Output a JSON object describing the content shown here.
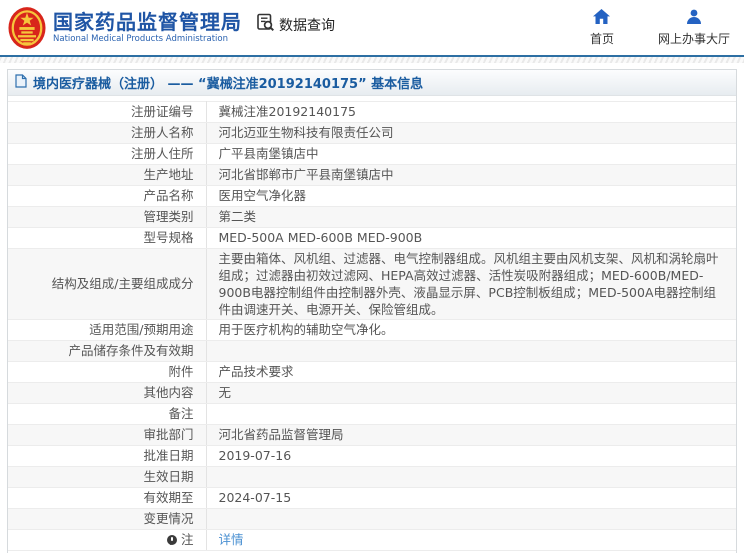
{
  "header": {
    "brand_cn": "国家药品监督管理局",
    "brand_en": "National Medical Products Administration",
    "query_label": "数据查询",
    "nav": [
      {
        "label": "首页",
        "icon": "home-icon"
      },
      {
        "label": "网上办事大厅",
        "icon": "user-icon"
      }
    ]
  },
  "breadcrumb": {
    "title": "境内医疗器械（注册） —— “冀械注准20192140175” 基本信息"
  },
  "table": {
    "rows": [
      {
        "label": "注册证编号",
        "value": "冀械注准20192140175"
      },
      {
        "label": "注册人名称",
        "value": "河北迈亚生物科技有限责任公司"
      },
      {
        "label": "注册人住所",
        "value": "广平县南堡镇店中"
      },
      {
        "label": "生产地址",
        "value": "河北省邯郸市广平县南堡镇店中"
      },
      {
        "label": "产品名称",
        "value": "医用空气净化器"
      },
      {
        "label": "管理类别",
        "value": "第二类"
      },
      {
        "label": "型号规格",
        "value": "MED-500A MED-600B MED-900B"
      },
      {
        "label": "结构及组成/主要组成成分",
        "value": "主要由箱体、风机组、过滤器、电气控制器组成。风机组主要由风机支架、风机和涡轮扇叶组成；过滤器由初效过滤网、HEPA高效过滤器、活性炭吸附器组成；MED-600B/MED-900B电器控制组件由控制器外壳、液晶显示屏、PCB控制板组成；MED-500A电器控制组件由调速开关、电源开关、保险管组成。",
        "tall": true
      },
      {
        "label": "适用范围/预期用途",
        "value": "用于医疗机构的辅助空气净化。"
      },
      {
        "label": "产品储存条件及有效期",
        "value": ""
      },
      {
        "label": "附件",
        "value": "产品技术要求"
      },
      {
        "label": "其他内容",
        "value": "无"
      },
      {
        "label": "备注",
        "value": ""
      },
      {
        "label": "审批部门",
        "value": "河北省药品监督管理局"
      },
      {
        "label": "批准日期",
        "value": "2019-07-16"
      },
      {
        "label": "生效日期",
        "value": ""
      },
      {
        "label": "有效期至",
        "value": "2024-07-15"
      },
      {
        "label": "变更情况",
        "value": ""
      },
      {
        "label": "注",
        "value": "详情",
        "link": true,
        "label_icon": "note-balloon-icon"
      }
    ]
  },
  "colors": {
    "brand_blue": "#1f55a5",
    "header_rule": "#2d6fa3",
    "title_blue": "#1a5ca0",
    "link_blue": "#4a90d2",
    "row_stripe": "#f7f7f7",
    "text_gray": "#555555"
  }
}
